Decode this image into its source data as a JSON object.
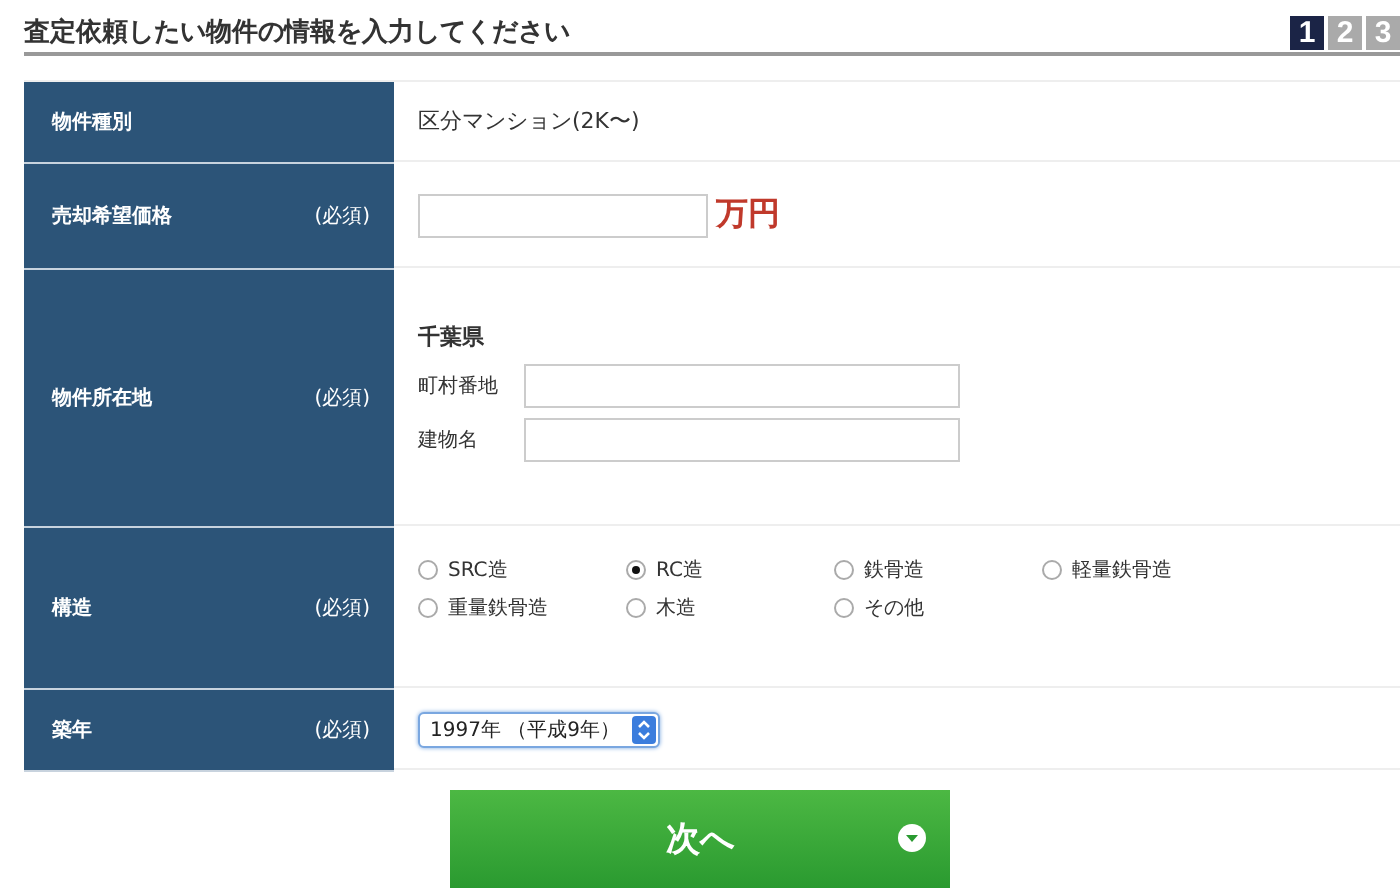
{
  "heading": "査定依頼したい物件の情報を入力してください",
  "steps": [
    {
      "label": "1",
      "selected": true
    },
    {
      "label": "2",
      "selected": false
    },
    {
      "label": "3",
      "selected": false
    }
  ],
  "rows": [
    {
      "kind": "text",
      "label": "物件種別",
      "value": "区分マンション(2K〜)"
    },
    {
      "kind": "price",
      "label": "売却希望価格",
      "required": "(必須)",
      "unit": "万円"
    },
    {
      "kind": "address",
      "label": "物件所在地",
      "required": "(必須)",
      "prefecture": "千葉県",
      "fields": [
        {
          "label": "町村番地"
        },
        {
          "label": "建物名"
        }
      ]
    },
    {
      "kind": "radios",
      "label": "構造",
      "required": "(必須)",
      "options": [
        {
          "label": "SRC造",
          "selected": false
        },
        {
          "label": "RC造",
          "selected": true
        },
        {
          "label": "鉄骨造",
          "selected": false
        },
        {
          "label": "軽量鉄骨造",
          "selected": false
        },
        {
          "label": "重量鉄骨造",
          "selected": false
        },
        {
          "label": "木造",
          "selected": false
        },
        {
          "label": "その他",
          "selected": false
        }
      ]
    },
    {
      "kind": "select",
      "label": "築年",
      "required": "(必須)",
      "value": "1997年 （平成9年）"
    }
  ],
  "next_button": "次へ"
}
